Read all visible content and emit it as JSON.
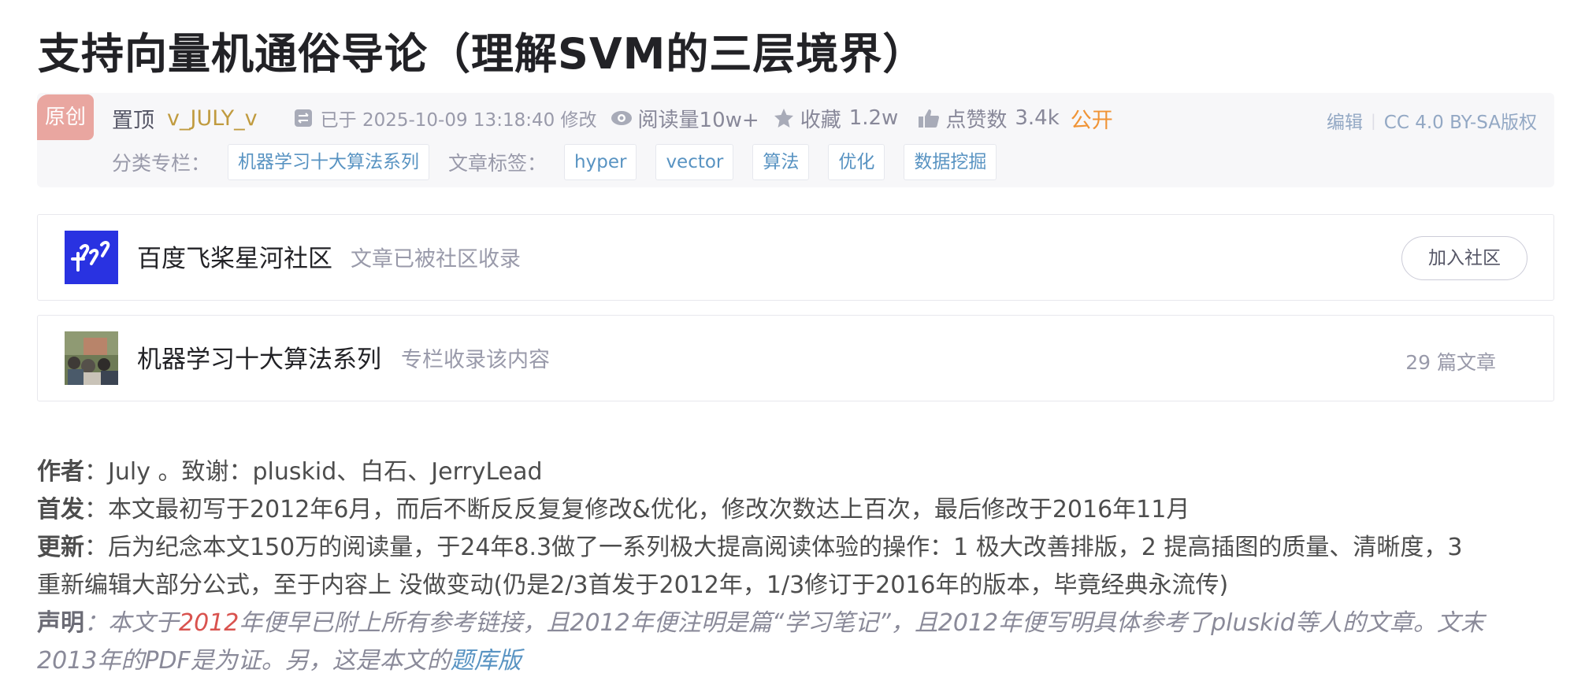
{
  "article": {
    "title": "支持向量机通俗导论（理解SVM的三层境界）"
  },
  "meta": {
    "badge": "原创",
    "pinned": "置顶",
    "author": "v_JULY_v",
    "modified": "已于 2025-10-09 13:18:40 修改",
    "views": "阅读量10w+",
    "favorites_label": "收藏",
    "favorites_count": "1.2w",
    "likes_label": "点赞数",
    "likes_count": "3.4k",
    "visibility": "公开",
    "edit": "编辑",
    "license": "CC 4.0 BY-SA版权",
    "category_label": "分类专栏：",
    "category": "机器学习十大算法系列",
    "tags_label": "文章标签：",
    "tags": [
      "hyper",
      "vector",
      "算法",
      "优化",
      "数据挖掘"
    ]
  },
  "community_card": {
    "name": "百度飞桨星河社区",
    "subtitle": "文章已被社区收录",
    "join_button": "加入社区",
    "logo_color": "#2932e1"
  },
  "column_card": {
    "name": "机器学习十大算法系列",
    "subtitle": "专栏收录该内容",
    "count": "29 篇文章"
  },
  "content": {
    "author_label": "作者",
    "author_text": "：July 。致谢：pluskid、白石、JerryLead",
    "first_label": "首发",
    "first_text": "：本文最初写于2012年6月，而后不断反反复复修改&优化，修改次数达上百次，最后修改于2016年11月",
    "update_label": "更新",
    "update_text_1": "：后为纪念本文150万的阅读量，于24年8.3做了一系列极大提高阅读体验的操作：1 极大改善排版，2 提高插图的质量、清晰度，3",
    "update_text_2": "重新编辑大部分公式，至于内容上 没做变动(仍是2/3首发于2012年，1/3修订于2016年的版本，毕竟经典永流传)",
    "statement_label": "声明",
    "statement_a": "：本文于",
    "statement_red": "2012",
    "statement_b": "年便早已附上所有参考链接，且2012年便注明是篇“学习笔记”，且2012年便写明具体参考了pluskid等人的文章。文末",
    "statement_c": "2013年的PDF是为证。另，这是本文的",
    "statement_link": "题库版"
  }
}
